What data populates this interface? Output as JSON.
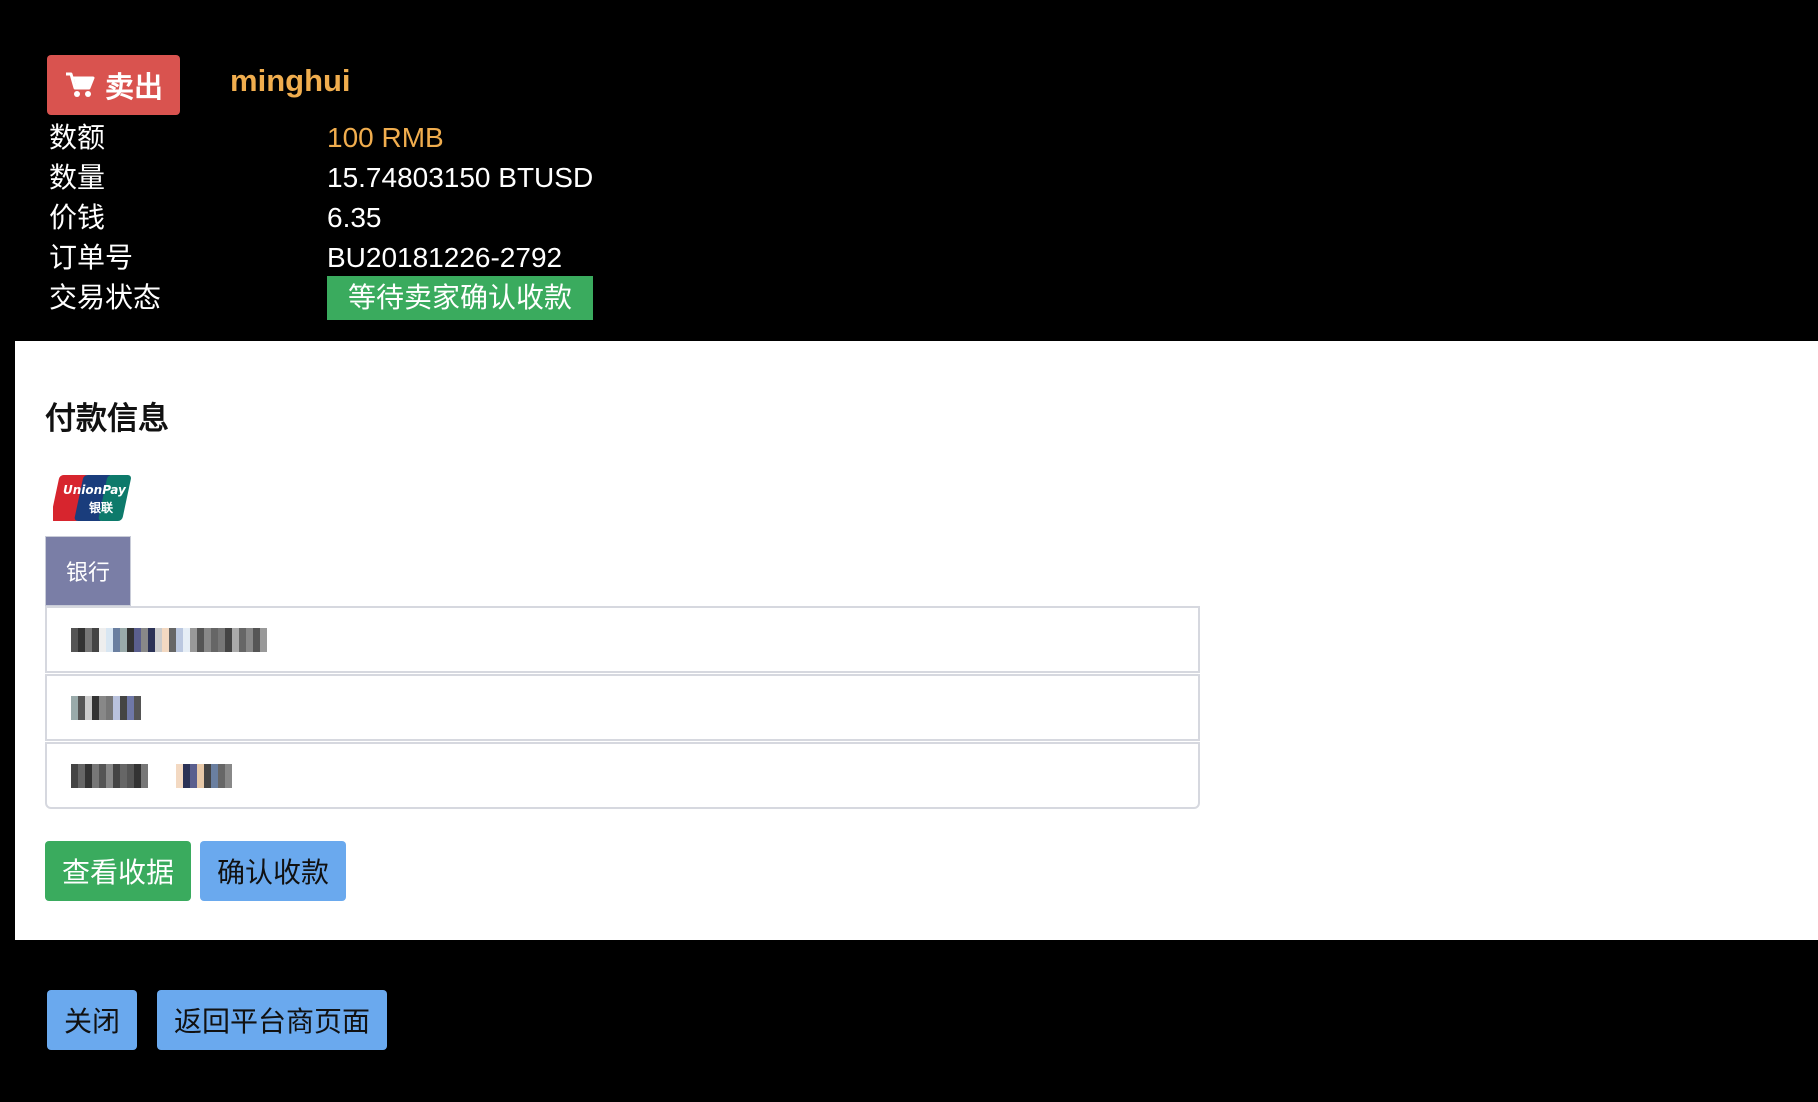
{
  "order": {
    "badge_label": "卖出",
    "badge_icon": "cart-icon",
    "username": "minghui",
    "rows": [
      {
        "label": "数额",
        "value": "100 RMB"
      },
      {
        "label": "数量",
        "value": "15.74803150 BTUSD"
      },
      {
        "label": "价钱",
        "value": "6.35"
      },
      {
        "label": "订单号",
        "value": "BU20181226-2792"
      },
      {
        "label": "交易状态",
        "value": "等待卖家确认收款"
      }
    ]
  },
  "payment": {
    "title": "付款信息",
    "logo": "unionpay-logo",
    "bank_tab_label": "银行",
    "fields": [
      "account-number-redacted",
      "account-holder-redacted",
      "bank-branch-redacted"
    ]
  },
  "actions": {
    "view_receipt": "查看收据",
    "confirm_payment": "确认收款",
    "close": "关闭",
    "return_merchant": "返回平台商页面"
  },
  "colors": {
    "sell_badge": "#d9534f",
    "username": "#f0ad4e",
    "status_badge": "#3aab5e",
    "bank_tab": "#7a7ea6",
    "blue_button": "#6aa9ee"
  }
}
